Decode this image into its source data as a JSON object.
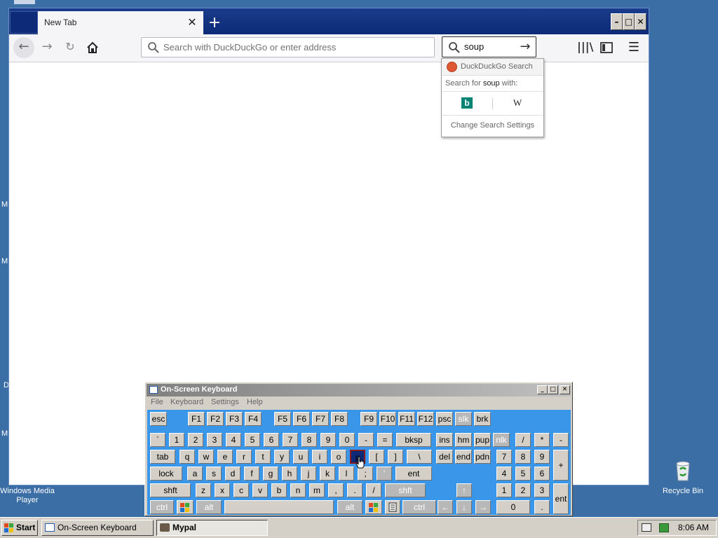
{
  "desktop": {
    "left_labels": [
      "M",
      "M",
      "D",
      "M"
    ],
    "wmp_label": "Windows Media Player",
    "recycle_label": "Recycle Bin"
  },
  "browser": {
    "tab_title": "New Tab",
    "tab_close": "✕",
    "new_tab": "+",
    "win_min": "–",
    "win_max": "□",
    "win_close": "✕",
    "url_placeholder": "Search with DuckDuckGo or enter address",
    "search_value": "soup",
    "icons": [
      "back-arrow-icon",
      "forward-arrow-icon",
      "reload-icon",
      "home-icon",
      "search-icon",
      "arrow-right-icon",
      "library-icon",
      "sidebar-icon",
      "menu-icon"
    ]
  },
  "search_popup": {
    "engine": "DuckDuckGo Search",
    "search_for_prefix": "Search for ",
    "search_term": "soup",
    "search_for_suffix": " with:",
    "settings": "Change Search Settings",
    "engines": [
      "bing-icon",
      "wikipedia-icon"
    ]
  },
  "osk": {
    "title": "On-Screen Keyboard",
    "menu": [
      "File",
      "Keyboard",
      "Settings",
      "Help"
    ],
    "rows": {
      "fn": [
        "esc",
        "F1",
        "F2",
        "F3",
        "F4",
        "F5",
        "F6",
        "F7",
        "F8",
        "F9",
        "F10",
        "F11",
        "F12",
        "psc",
        "slk",
        "brk"
      ],
      "num": [
        "`",
        "1",
        "2",
        "3",
        "4",
        "5",
        "6",
        "7",
        "8",
        "9",
        "0",
        "-",
        "=",
        "bksp",
        "ins",
        "hm",
        "pup",
        "nlk",
        "/",
        "*",
        "-"
      ],
      "q": [
        "tab",
        "q",
        "w",
        "e",
        "r",
        "t",
        "y",
        "u",
        "i",
        "o",
        "p",
        "[",
        "]",
        "\\",
        "del",
        "end",
        "pdn",
        "7",
        "8",
        "9",
        "+"
      ],
      "a": [
        "lock",
        "a",
        "s",
        "d",
        "f",
        "g",
        "h",
        "j",
        "k",
        "l",
        ";",
        "'",
        "ent",
        "4",
        "5",
        "6"
      ],
      "z": [
        "shft",
        "z",
        "x",
        "c",
        "v",
        "b",
        "n",
        "m",
        ",",
        ".",
        "/",
        "shft",
        "↑",
        "1",
        "2",
        "3",
        "ent"
      ],
      "ctrl": [
        "ctrl",
        "",
        "alt",
        "",
        "alt",
        "",
        "",
        "ctrl",
        "←",
        "↓",
        "→",
        "0",
        "."
      ]
    }
  },
  "taskbar": {
    "start": "Start",
    "tasks": [
      "On-Screen Keyboard",
      "Mypal"
    ],
    "clock": "8:06 AM"
  }
}
